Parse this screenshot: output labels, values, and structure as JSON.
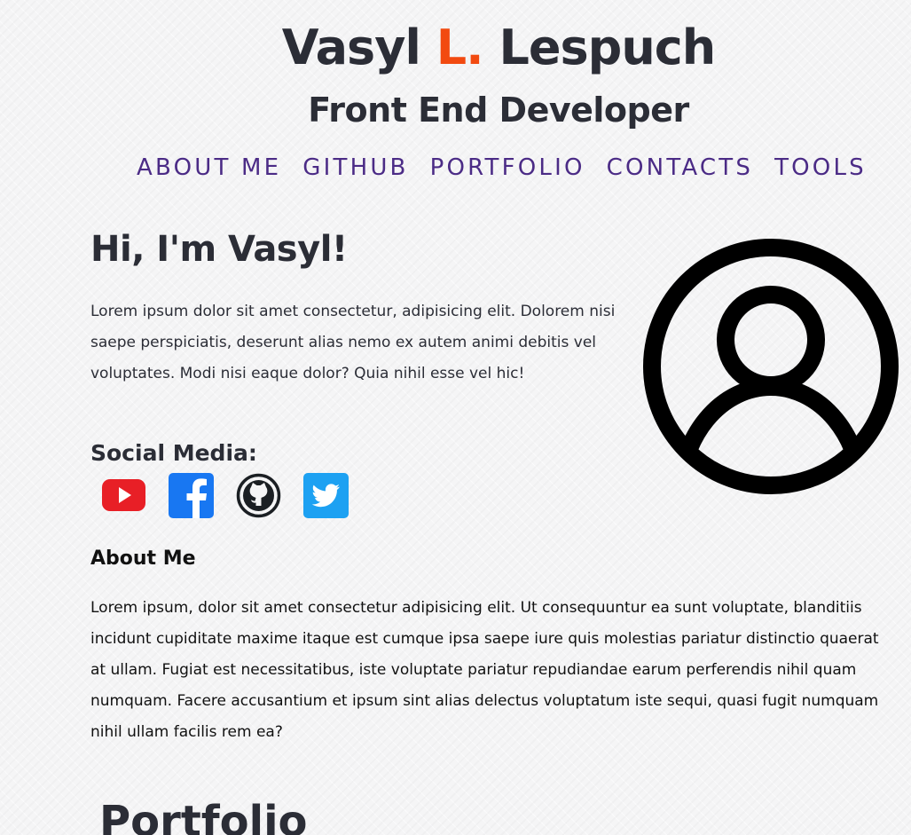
{
  "header": {
    "name_first": "Vasyl",
    "name_initial": "L.",
    "name_last": "Lespuch",
    "role": "Front End Developer",
    "accent_color": "#f24a10"
  },
  "nav": {
    "items": [
      {
        "label": "ABOUT ME"
      },
      {
        "label": "GITHUB"
      },
      {
        "label": "PORTFOLIO"
      },
      {
        "label": "CONTACTS"
      },
      {
        "label": "TOOLS"
      }
    ],
    "color": "#4b2b86"
  },
  "hero": {
    "title": "Hi, I'm Vasyl!",
    "intro": "Lorem ipsum dolor sit amet consectetur, adipisicing elit. Dolorem nisi saepe perspiciatis, deserunt alias nemo ex autem animi debitis vel voluptates. Modi nisi eaque dolor? Quia nihil esse vel hic!",
    "avatar_icon": "user-avatar-icon"
  },
  "social": {
    "title": "Social Media:",
    "links": [
      {
        "icon": "youtube-icon",
        "color": "#e81f26"
      },
      {
        "icon": "facebook-icon",
        "color": "#1877f2"
      },
      {
        "icon": "github-icon",
        "color": "#1b1f23"
      },
      {
        "icon": "twitter-icon",
        "color": "#1da1f2"
      }
    ]
  },
  "about": {
    "title": "About Me",
    "text": "Lorem ipsum, dolor sit amet consectetur adipisicing elit. Ut consequuntur ea sunt voluptate, blanditiis incidunt cupiditate maxime itaque est cumque ipsa saepe iure quis molestias pariatur distinctio quaerat at ullam. Fugiat est necessitatibus, iste voluptate pariatur repudiandae earum perferendis nihil quam numquam. Facere accusantium et ipsum sint alias delectus voluptatum iste sequi, quasi fugit numquam nihil ullam facilis rem ea?"
  },
  "portfolio": {
    "title": "Portfolio"
  }
}
